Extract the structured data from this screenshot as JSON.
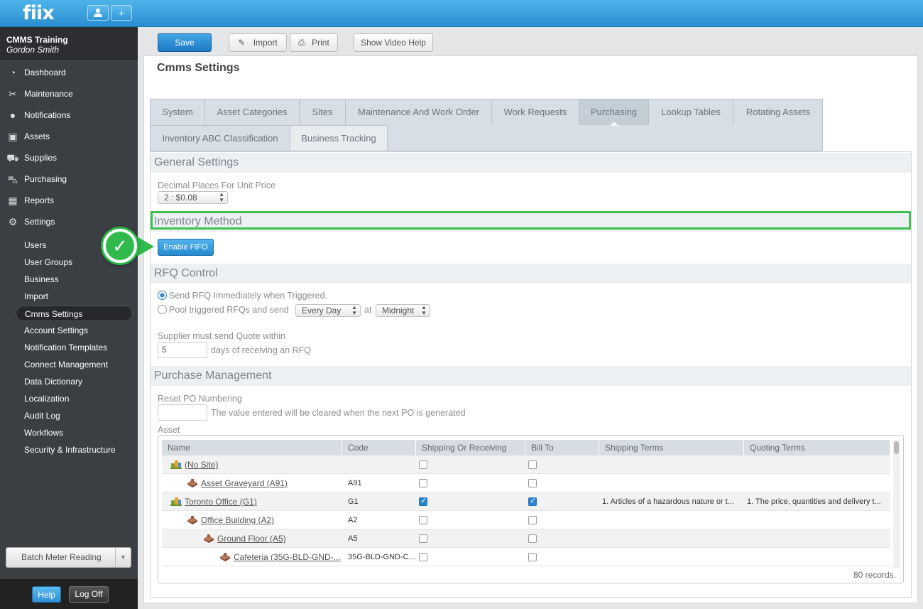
{
  "app": {
    "logo": "fiix",
    "user_icon": "user-icon",
    "add_icon": "+"
  },
  "user": {
    "company": "CMMS Training",
    "name": "Gordon Smith"
  },
  "nav": {
    "main": [
      {
        "label": "Dashboard",
        "icon": "dashboard-icon"
      },
      {
        "label": "Maintenance",
        "icon": "tools-icon"
      },
      {
        "label": "Notifications",
        "icon": "chat-bubble-icon"
      },
      {
        "label": "Assets",
        "icon": "box-icon"
      },
      {
        "label": "Supplies",
        "icon": "truck-icon"
      },
      {
        "label": "Purchasing",
        "icon": "cart-icon"
      },
      {
        "label": "Reports",
        "icon": "chart-icon"
      },
      {
        "label": "Settings",
        "icon": "gear-icon"
      }
    ],
    "settings_sub": [
      "Users",
      "User Groups",
      "Business",
      "Import",
      "Cmms Settings",
      "Account Settings",
      "Notification Templates",
      "Connect Management",
      "Data Dictionary",
      "Localization",
      "Audit Log",
      "Workflows",
      "Security & Infrastructure"
    ],
    "batch": "Batch Meter Reading",
    "help": "Help",
    "logoff": "Log Off"
  },
  "toolbar": {
    "save": "Save",
    "import": "Import",
    "print": "Print",
    "video": "Show Video Help"
  },
  "page": {
    "title": "Cmms Settings"
  },
  "tabs": {
    "row1": [
      "System",
      "Asset Categories",
      "Sites",
      "Maintenance And Work Order",
      "Work Requests",
      "Purchasing",
      "Lookup Tables",
      "Rotating Assets"
    ],
    "row2": [
      "Inventory ABC Classification",
      "Business Tracking"
    ],
    "active": "Purchasing"
  },
  "general": {
    "title": "General Settings",
    "decimal_label": "Decimal Places For Unit Price",
    "decimal_value": "2 : $0.08"
  },
  "inventory": {
    "title": "Inventory Method",
    "fifo_button": "Enable FIFO"
  },
  "rfq": {
    "title": "RFQ Control",
    "option1": "Send RFQ Immediately when Triggered.",
    "option2": "Pool triggered RFQs and send",
    "freq": "Every Day",
    "at": "at",
    "time": "Midnight",
    "supplier_label": "Supplier must send Quote within",
    "days_value": "5",
    "days_suffix": "days of receiving an RFQ"
  },
  "purchase": {
    "title": "Purchase Management",
    "reset_label": "Reset PO Numbering",
    "reset_note": "The value entered will be cleared when the next PO is generated",
    "asset_label": "Asset"
  },
  "grid": {
    "headers": [
      "Name",
      "Code",
      "Shipping Or Receiving",
      "Bill To",
      "Shipping Terms",
      "Quoting Terms"
    ],
    "rows": [
      {
        "name": "(No Site)",
        "code": "",
        "ship": false,
        "bill": false,
        "sterms": "",
        "qterms": ""
      },
      {
        "name": "Asset Graveyard (A91)",
        "code": "A91",
        "ship": false,
        "bill": false,
        "sterms": "",
        "qterms": ""
      },
      {
        "name": "Toronto Office (G1)",
        "code": "G1",
        "ship": true,
        "bill": true,
        "sterms": "1. Articles of a hazardous nature or t...",
        "qterms": "1. The price, quantities and delivery t..."
      },
      {
        "name": "Office Building (A2)",
        "code": "A2",
        "ship": false,
        "bill": false,
        "sterms": "",
        "qterms": ""
      },
      {
        "name": "Ground Floor (A5)",
        "code": "A5",
        "ship": false,
        "bill": false,
        "sterms": "",
        "qterms": ""
      },
      {
        "name": "Cafeteria (35G-BLD-GND-...",
        "code": "35G-BLD-GND-C...",
        "ship": false,
        "bill": false,
        "sterms": "",
        "qterms": ""
      }
    ],
    "records": "80 records."
  },
  "colors": {
    "accent": "#2a8fd0",
    "highlight": "#3fc152",
    "sidebar": "#3b3e42"
  }
}
